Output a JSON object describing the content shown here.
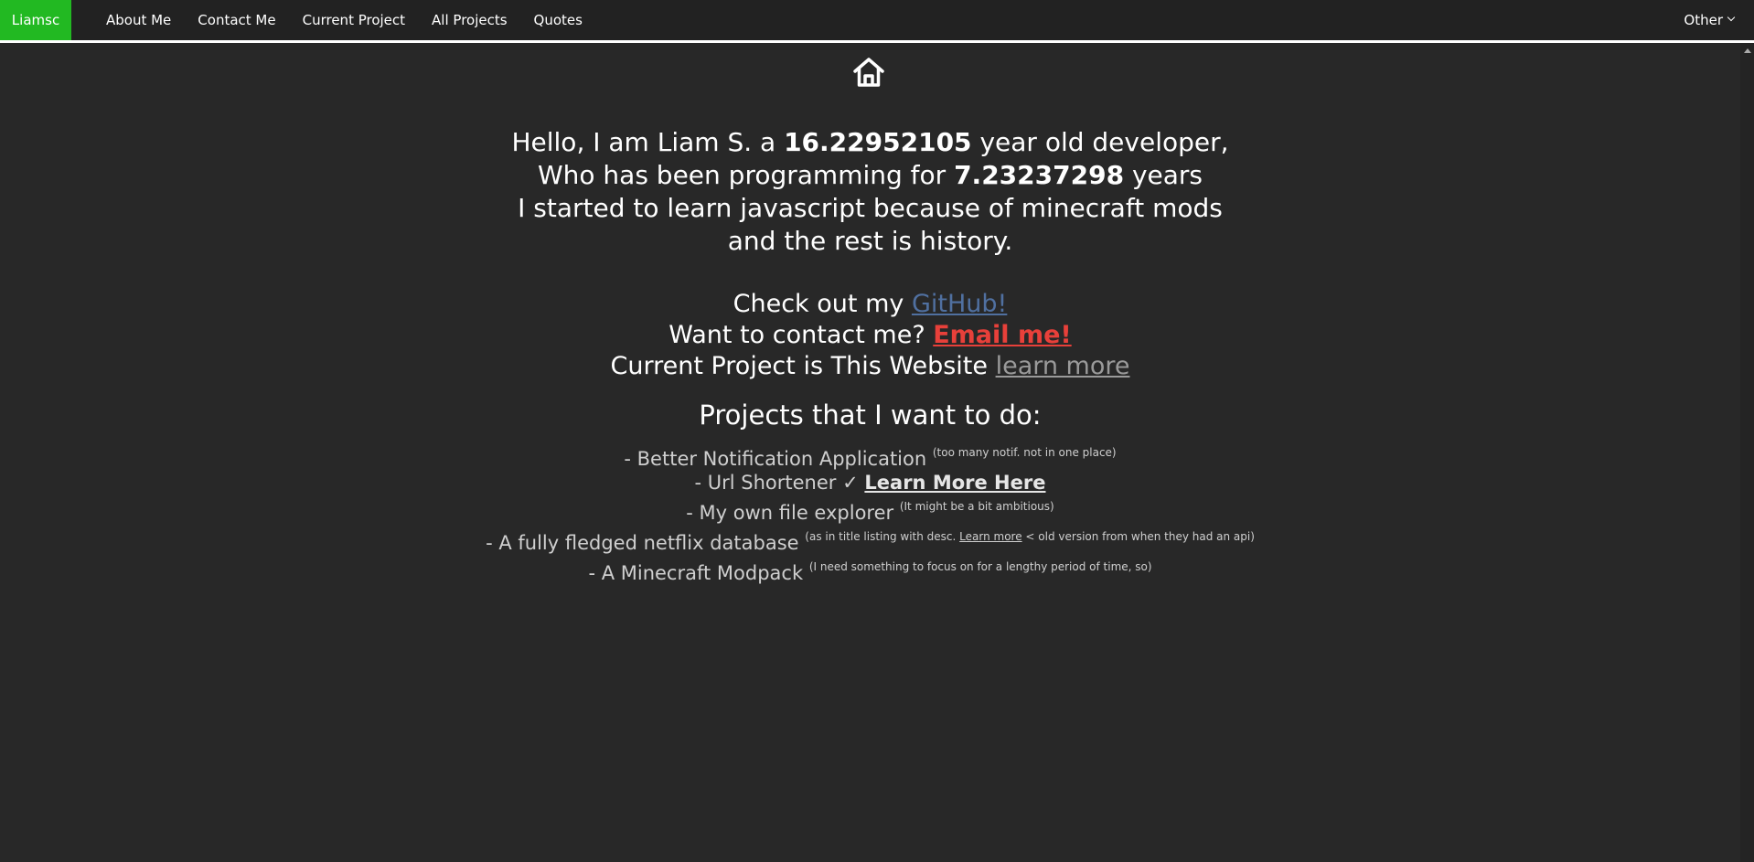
{
  "navbar": {
    "brand": "Liamsc",
    "links": [
      "About Me",
      "Contact Me",
      "Current Project",
      "All Projects",
      "Quotes"
    ],
    "other_label": "Other",
    "brand_color": "#22b922"
  },
  "home_icon": "home-icon",
  "intro": {
    "line1_prefix": "Hello, I am Liam S. a ",
    "age": "16.22952105",
    "line1_suffix": " year old developer,",
    "line2_prefix": "Who has been programming for ",
    "years": "7.23237298",
    "line2_suffix": " years",
    "line3": "I started to learn javascript because of minecraft mods",
    "line4": "and the rest is history."
  },
  "links": {
    "github_prefix": "Check out my ",
    "github_label": "GitHub!",
    "contact_prefix": "Want to contact me? ",
    "email_label": "Email me!",
    "project_prefix": "Current Project is This Website ",
    "learn_more_label": "learn more"
  },
  "projects": {
    "title": "Projects that I want to do:",
    "items": [
      {
        "text": "- Better Notification Application",
        "note": "(too many notif. not in one place)"
      },
      {
        "text": "- Url Shortener",
        "check": "✓",
        "link": "Learn More Here"
      },
      {
        "text": "- My own file explorer",
        "note": "(It might be a bit ambitious)"
      },
      {
        "text": "- A fully fledged netflix database",
        "note_prefix": "(as in title listing with desc. ",
        "note_link": "Learn more",
        "note_suffix": " < old version from when they had an api)"
      },
      {
        "text": "- A Minecraft Modpack",
        "note": "(I need something to focus on for a lengthy period of time, so)"
      }
    ]
  },
  "colors": {
    "background": "#282828",
    "navbar": "#222222",
    "github": "#5070a0",
    "email": "#e8403a"
  }
}
